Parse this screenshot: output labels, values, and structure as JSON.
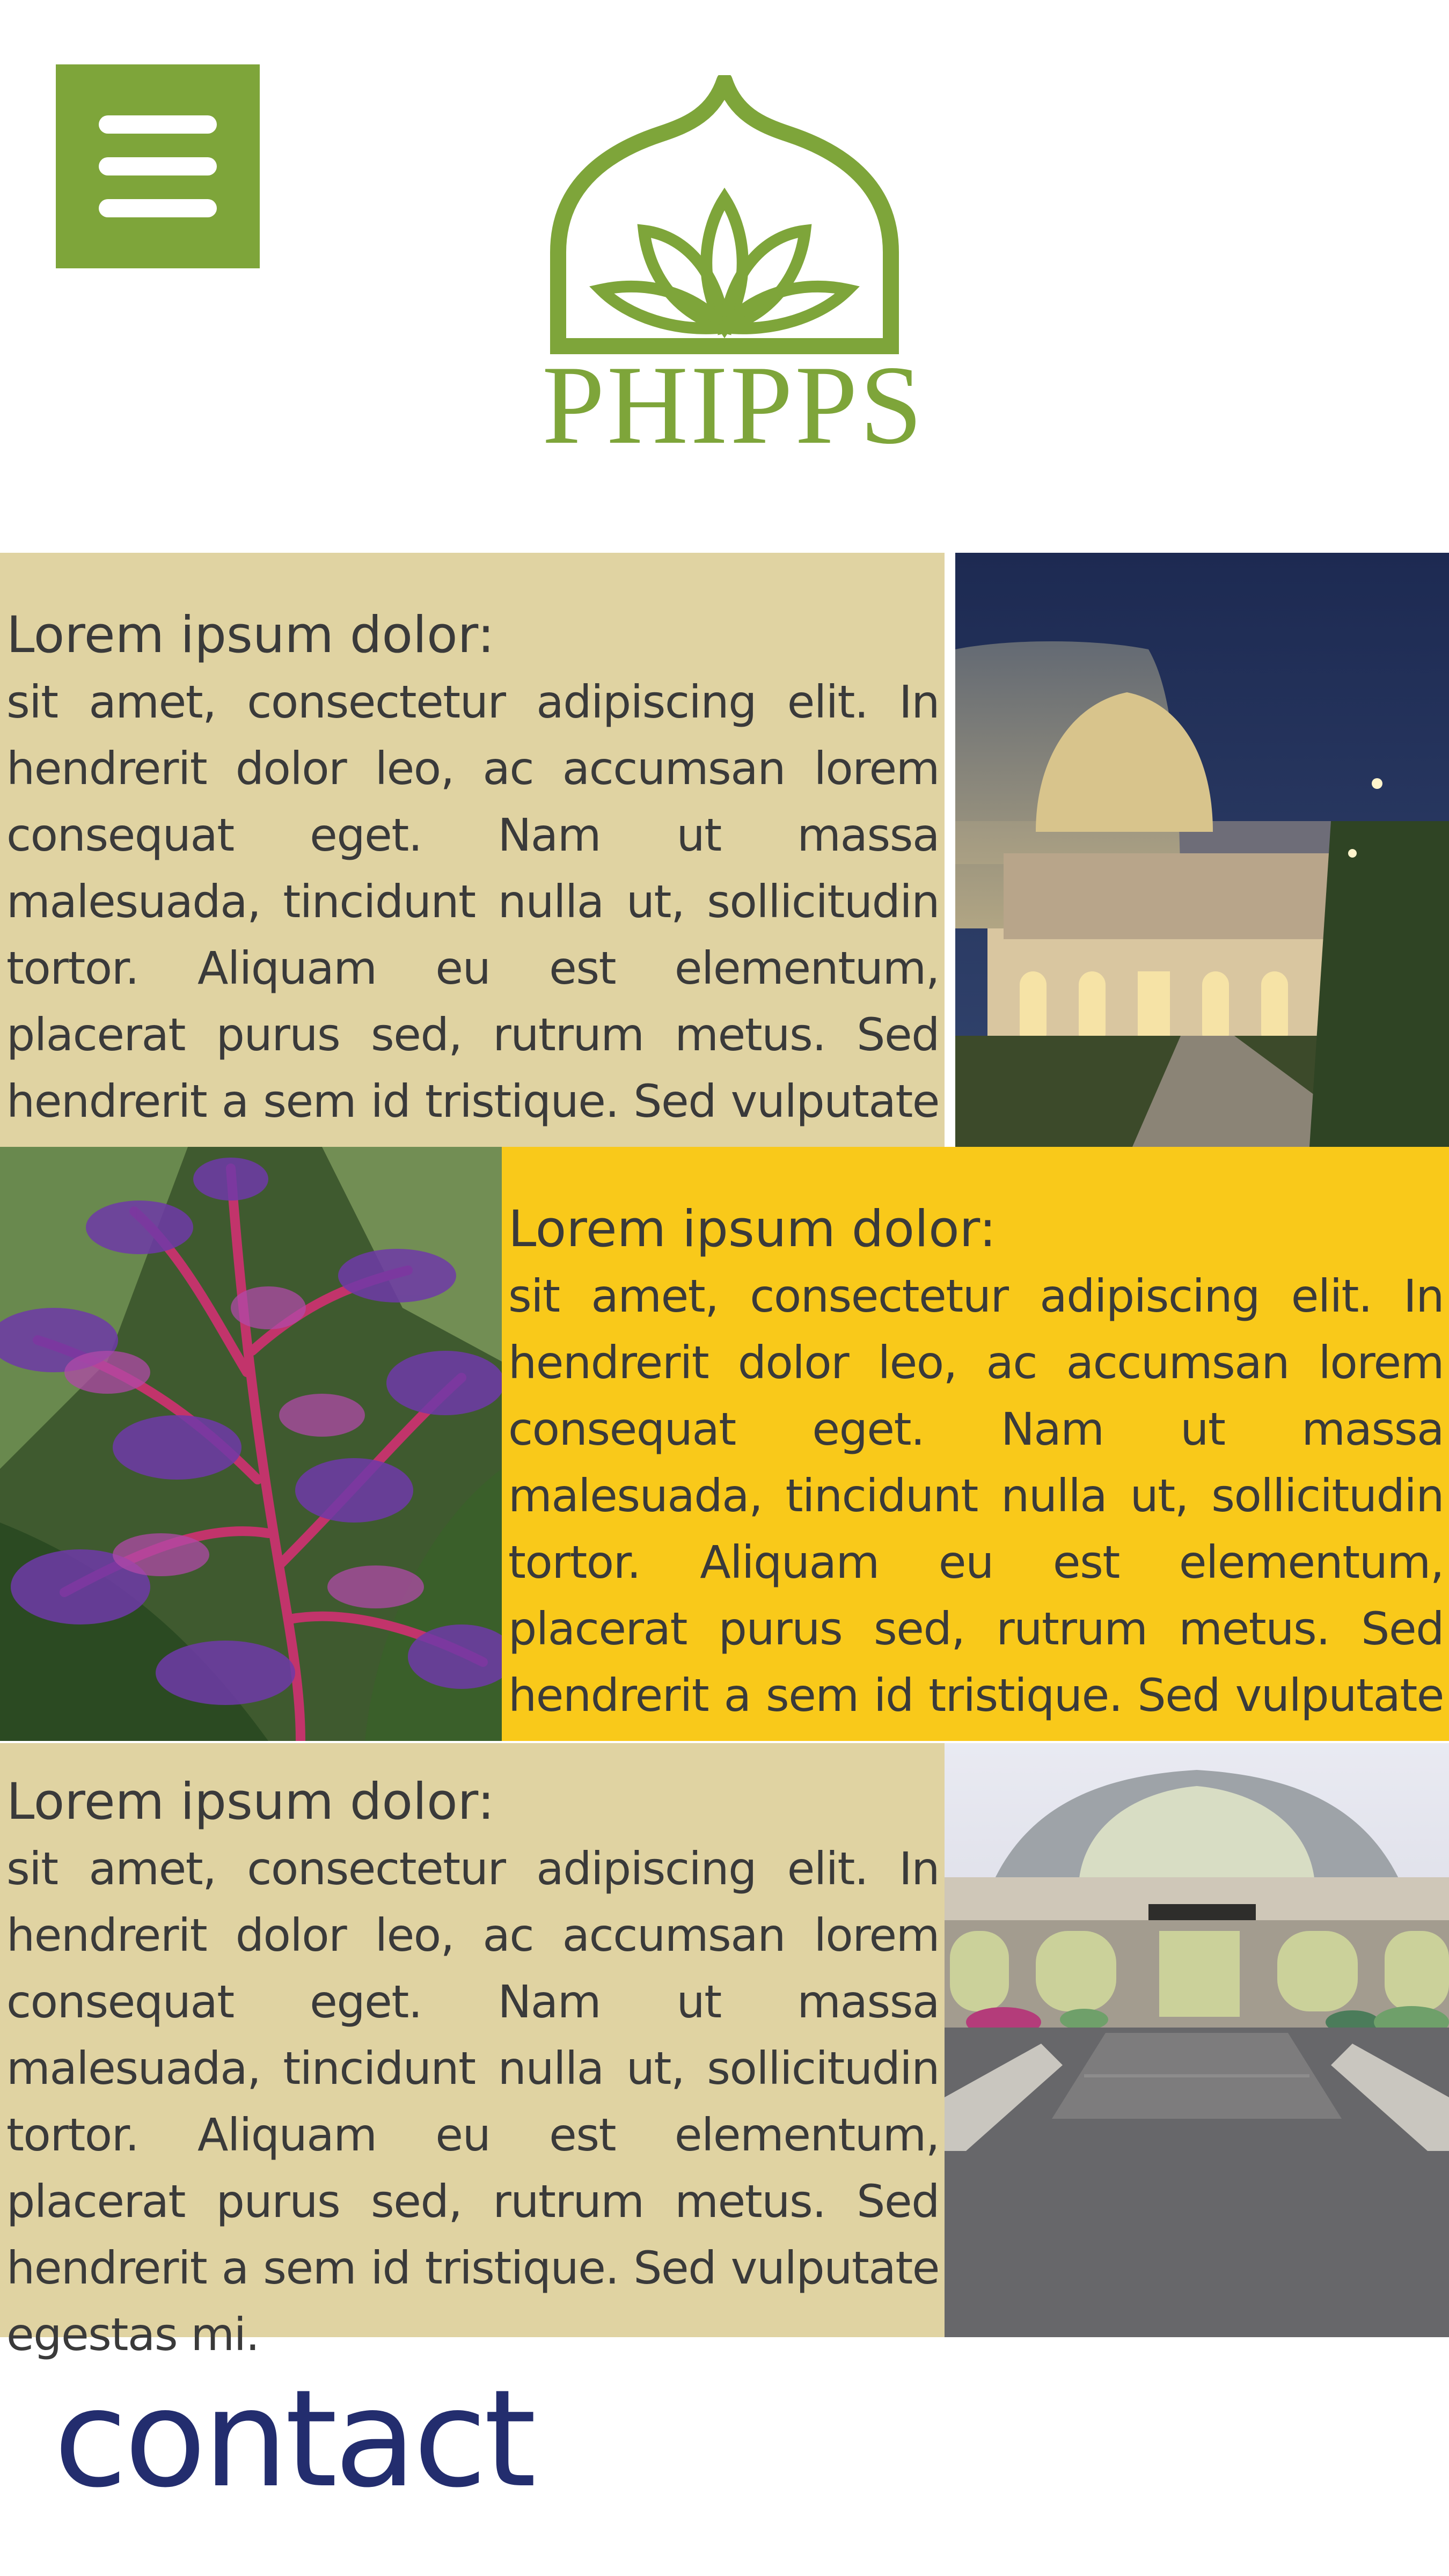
{
  "header": {
    "menu_icon": "hamburger-menu-icon",
    "logo_text": "PHIPPS",
    "logo_icon": "lotus-dome-icon",
    "brand_color": "#7ea53a"
  },
  "sections": [
    {
      "heading": "Lorem ipsum dolor:",
      "body": "sit amet, consectetur adipiscing elit. In hendrerit dolor leo, ac accumsan lorem consequat eget. Nam ut massa malesuada, tincidunt nulla ut, sollicitudin tortor. Aliquam eu est elementum, placerat purus sed, rutrum metus. Sed hendrerit a sem id tristique. Sed vulputate egestas mi.",
      "background": "#e0d3a2",
      "photo": "conservatory-night-photo"
    },
    {
      "heading": "Lorem ipsum dolor:",
      "body": "sit amet, consectetur adipiscing elit. In hendrerit dolor leo, ac accumsan lorem consequat eget. Nam ut massa malesuada, tincidunt nulla ut, sollicitudin tortor. Aliquam eu est elementum, placerat purus sed, rutrum metus. Sed hendrerit a sem id tristique. Sed vulputate egestas mi.",
      "background": "#f9c91a",
      "photo": "bromeliad-flower-photo"
    },
    {
      "heading": "Lorem ipsum dolor:",
      "body": "sit amet, consectetur adipiscing elit. In hendrerit dolor leo, ac accumsan lorem consequat eget. Nam ut massa malesuada, tincidunt nulla ut, sollicitudin tortor. Aliquam eu est elementum, placerat purus sed, rutrum metus. Sed hendrerit a sem id tristique. Sed vulputate egestas mi.",
      "background": "#e0d3a2",
      "photo": "conservatory-entrance-photo"
    }
  ],
  "contact": {
    "label": "contact",
    "color": "#232d6e"
  }
}
